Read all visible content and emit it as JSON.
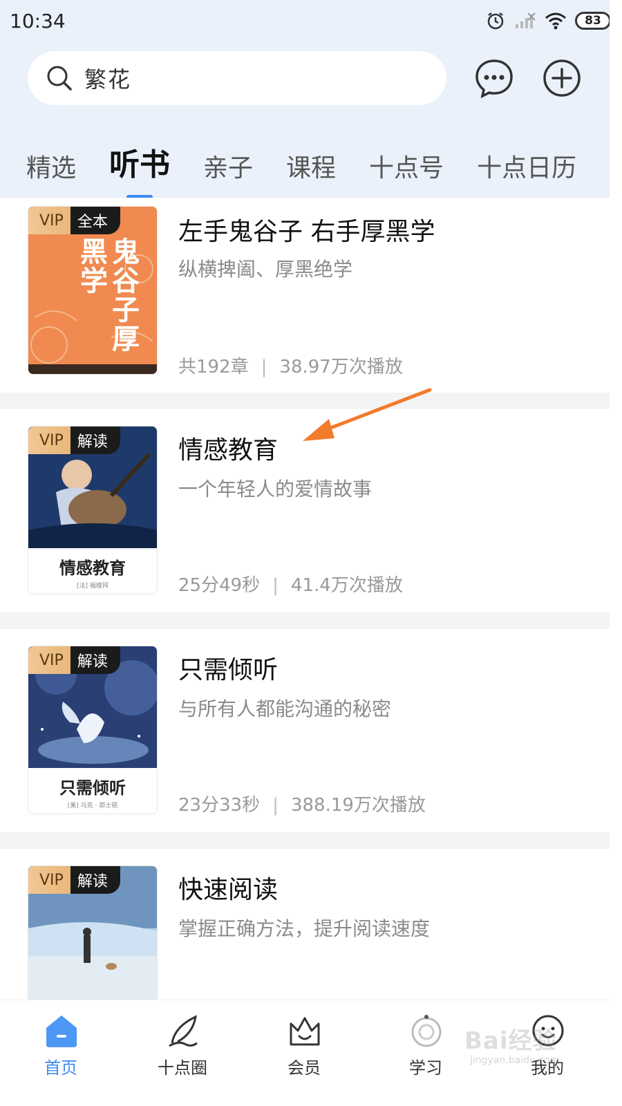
{
  "status_bar": {
    "time": "10:34",
    "battery": "83"
  },
  "search": {
    "text": "繁花"
  },
  "tabs": [
    {
      "label": "精选"
    },
    {
      "label": "听书"
    },
    {
      "label": "亲子"
    },
    {
      "label": "课程"
    },
    {
      "label": "十点号"
    },
    {
      "label": "十点日历"
    }
  ],
  "books": [
    {
      "badge_vip": "VIP",
      "badge_type": "全本",
      "cover_text": "鬼谷子厚黑学",
      "title": "左手鬼谷子 右手厚黑学",
      "subtitle": "纵横捭阖、厚黑绝学",
      "meta1": "共192章",
      "meta2": "38.97万次播放"
    },
    {
      "badge_vip": "VIP",
      "badge_type": "解读",
      "cover_title": "情感教育",
      "cover_author": "[法] 福楼拜",
      "title": "情感教育",
      "subtitle": "一个年轻人的爱情故事",
      "meta1": "25分49秒",
      "meta2": "41.4万次播放"
    },
    {
      "badge_vip": "VIP",
      "badge_type": "解读",
      "cover_title": "只需倾听",
      "cover_author": "[美] 马克 · 郭士顿",
      "title": "只需倾听",
      "subtitle": "与所有人都能沟通的秘密",
      "meta1": "23分33秒",
      "meta2": "388.19万次播放"
    },
    {
      "badge_vip": "VIP",
      "badge_type": "解读",
      "title": "快速阅读",
      "subtitle": "掌握正确方法，提升阅读速度"
    }
  ],
  "nav": [
    {
      "label": "首页"
    },
    {
      "label": "十点圈"
    },
    {
      "label": "会员"
    },
    {
      "label": "学习"
    },
    {
      "label": "我的"
    }
  ],
  "watermark": {
    "text": "Bai经验",
    "sub": "jingyan.baidu.com"
  },
  "colors": {
    "accent": "#3d8bf2",
    "annotation_arrow": "#f47a2c",
    "header_bg": "#eaf1fb"
  }
}
